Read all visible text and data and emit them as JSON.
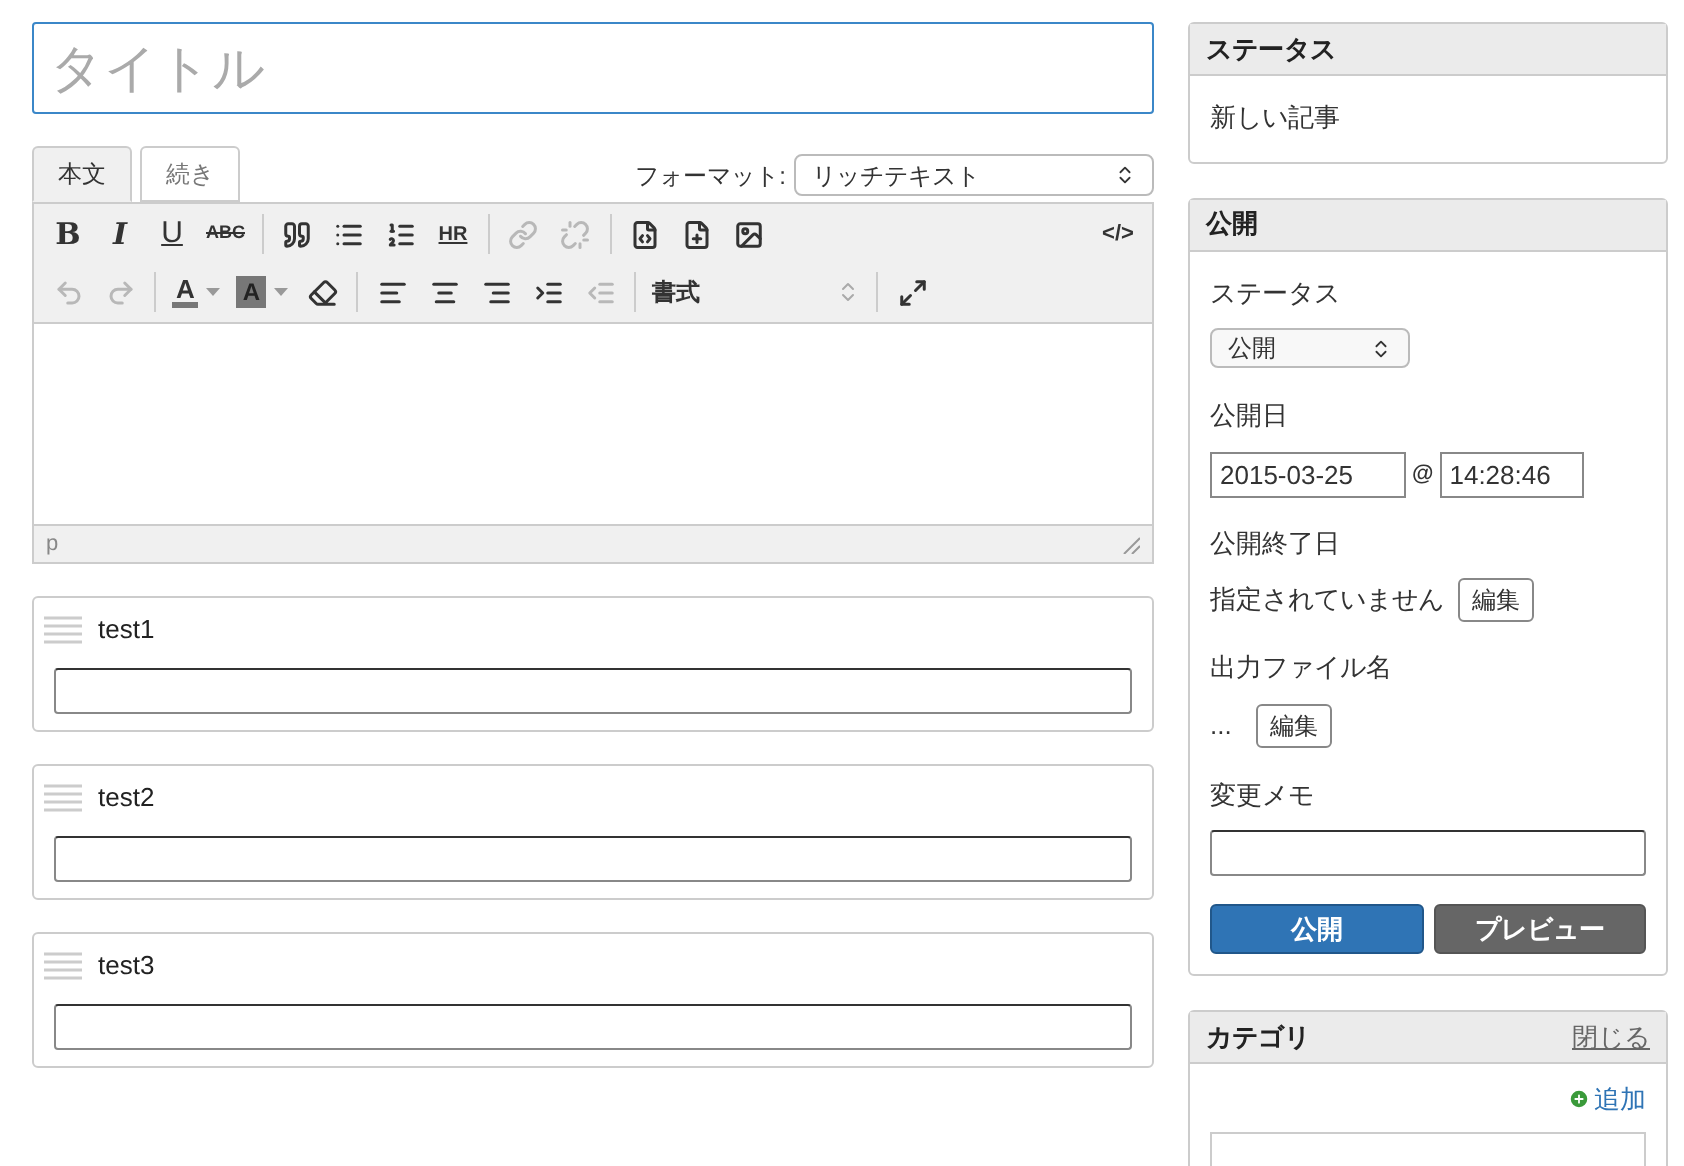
{
  "title_field": {
    "placeholder": "タイトル"
  },
  "tabs": [
    {
      "label": "本文",
      "selected": true
    },
    {
      "label": "続き",
      "selected": false
    }
  ],
  "format": {
    "label": "フォーマット:",
    "value": "リッチテキスト"
  },
  "toolbar_rows": [
    [
      {
        "kind": "bold",
        "label": "B",
        "disabled": false
      },
      {
        "kind": "italic",
        "label": "I",
        "disabled": false
      },
      {
        "kind": "underline",
        "label": "U",
        "disabled": false
      },
      {
        "kind": "strike",
        "label": "ABC",
        "disabled": false
      },
      {
        "kind": "separator"
      },
      {
        "kind": "quote",
        "disabled": false
      },
      {
        "kind": "bullets",
        "disabled": false
      },
      {
        "kind": "numbers",
        "disabled": false
      },
      {
        "kind": "rule",
        "label": "HR",
        "disabled": false
      },
      {
        "kind": "separator"
      },
      {
        "kind": "link",
        "disabled": true
      },
      {
        "kind": "unlink",
        "disabled": true
      },
      {
        "kind": "separator"
      },
      {
        "kind": "template",
        "disabled": false
      },
      {
        "kind": "newpage",
        "disabled": false
      },
      {
        "kind": "image",
        "disabled": false
      },
      {
        "kind": "spacer"
      },
      {
        "kind": "source",
        "label": "</>",
        "disabled": false
      }
    ],
    [
      {
        "kind": "undo",
        "disabled": true
      },
      {
        "kind": "redo",
        "disabled": true
      },
      {
        "kind": "separator"
      },
      {
        "kind": "forecolor",
        "label": "A",
        "disabled": false
      },
      {
        "kind": "backcolor",
        "label": "A",
        "disabled": false
      },
      {
        "kind": "eraser",
        "disabled": false
      },
      {
        "kind": "separator"
      },
      {
        "kind": "alignleft",
        "disabled": false
      },
      {
        "kind": "aligncenter",
        "disabled": false
      },
      {
        "kind": "alignright",
        "disabled": false
      },
      {
        "kind": "indent",
        "disabled": false
      },
      {
        "kind": "outdent",
        "disabled": true
      },
      {
        "kind": "separator"
      },
      {
        "kind": "styles",
        "label": "書式",
        "disabled": false
      },
      {
        "kind": "separator"
      },
      {
        "kind": "fullscreen",
        "disabled": false
      }
    ]
  ],
  "editor_path": "p",
  "custom_fields": [
    {
      "label": "test1"
    },
    {
      "label": "test2"
    },
    {
      "label": "test3"
    }
  ],
  "status_panel": {
    "title": "ステータス",
    "text": "新しい記事"
  },
  "publish_panel": {
    "title": "公開",
    "status_label": "ステータス",
    "status_value": "公開",
    "date_label": "公開日",
    "date": "2015-03-25",
    "at": "@",
    "time": "14:28:46",
    "end_label": "公開終了日",
    "end_value": "指定されていません",
    "end_button": "編集",
    "file_label": "出力ファイル名",
    "file_value": "...",
    "file_button": "編集",
    "memo_label": "変更メモ",
    "buttons": [
      {
        "label": "公開",
        "kind": "primary"
      },
      {
        "label": "プレビュー",
        "kind": "secondary"
      }
    ]
  },
  "category_panel": {
    "title": "カテゴリ",
    "close_link": "閉じる",
    "add_link": "追加"
  }
}
